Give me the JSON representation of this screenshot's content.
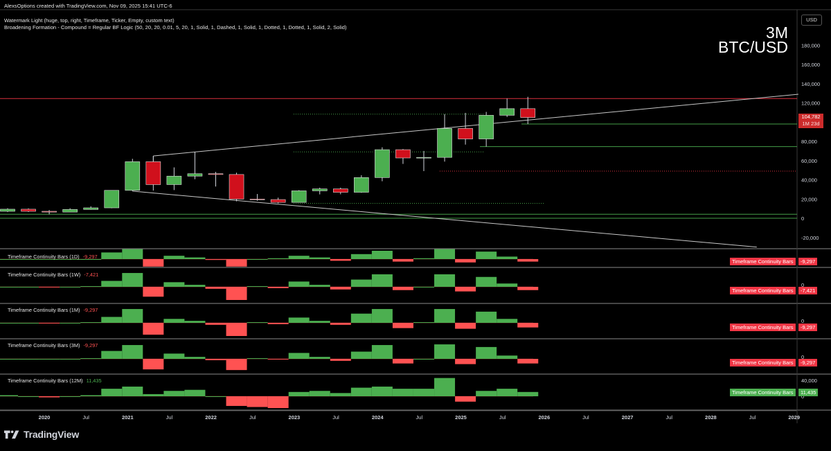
{
  "header": {
    "line1": "AlexsOptions created with TradingView.com, Nov 09, 2025 15:41 UTC-6",
    "line2": "Watermark Light (huge, top, right, Timeframe, Ticker, Empty, custom text)",
    "line3": "Broadening Formation - Compound = Regular BF Logic (50, 20, 20, 0.01, 5, 20, 1, Solid, 1, Dashed, 1, Solid, 1, Dotted, 1, Dotted, 1, Solid, 2, Solid)"
  },
  "currency_button": "USD",
  "watermark": {
    "timeframe": "3M",
    "ticker": "BTC/USD"
  },
  "price_badge": {
    "price": "104,782",
    "countdown": "1M 23d"
  },
  "colors": {
    "up": "#4caf50",
    "down": "#ff5252",
    "candle_down": "#d0101c",
    "background": "#000000",
    "resistance": "#f23645",
    "support": "#4caf50"
  },
  "chart_data": [
    {
      "type": "candlestick",
      "title": "BTC/USD 3M",
      "ylim": [
        -30000,
        205000
      ],
      "y_ticks": [
        -20000,
        0,
        20000,
        40000,
        60000,
        80000,
        100000,
        120000,
        140000,
        160000,
        180000
      ],
      "y_tick_labels": [
        "-20,000",
        "0",
        "20,000",
        "40,000",
        "60,000",
        "80,000",
        "100,000",
        "120,000",
        "140,000",
        "160,000",
        "180,000"
      ],
      "x_labels": [
        "2020",
        "Jul",
        "2021",
        "Jul",
        "2022",
        "Jul",
        "2023",
        "Jul",
        "2024",
        "Jul",
        "2025",
        "Jul",
        "2026",
        "Jul",
        "2027",
        "Jul",
        "2028",
        "Jul",
        "2029"
      ],
      "candles": [
        {
          "o": 7200,
          "h": 10400,
          "l": 6400,
          "c": 9400
        },
        {
          "o": 9400,
          "h": 10200,
          "l": 6500,
          "c": 7200
        },
        {
          "o": 7200,
          "h": 8500,
          "l": 4100,
          "c": 6400
        },
        {
          "o": 6400,
          "h": 10400,
          "l": 6400,
          "c": 9100
        },
        {
          "o": 9100,
          "h": 12400,
          "l": 8900,
          "c": 10800
        },
        {
          "o": 10800,
          "h": 29000,
          "l": 10400,
          "c": 29000
        },
        {
          "o": 29000,
          "h": 61800,
          "l": 28200,
          "c": 58800
        },
        {
          "o": 58800,
          "h": 64800,
          "l": 28800,
          "c": 35000
        },
        {
          "o": 35000,
          "h": 52900,
          "l": 29300,
          "c": 43800
        },
        {
          "o": 43800,
          "h": 69000,
          "l": 40600,
          "c": 46300
        },
        {
          "o": 46300,
          "h": 48200,
          "l": 33000,
          "c": 45500
        },
        {
          "o": 45500,
          "h": 47400,
          "l": 17600,
          "c": 19900
        },
        {
          "o": 19900,
          "h": 25200,
          "l": 18200,
          "c": 19400
        },
        {
          "o": 19400,
          "h": 21400,
          "l": 15500,
          "c": 16500
        },
        {
          "o": 16500,
          "h": 29200,
          "l": 16500,
          "c": 28500
        },
        {
          "o": 28500,
          "h": 31800,
          "l": 24800,
          "c": 30500
        },
        {
          "o": 30500,
          "h": 31800,
          "l": 24900,
          "c": 27000
        },
        {
          "o": 27000,
          "h": 44700,
          "l": 26500,
          "c": 42300
        },
        {
          "o": 42300,
          "h": 73800,
          "l": 38500,
          "c": 71300
        },
        {
          "o": 71300,
          "h": 72000,
          "l": 56500,
          "c": 62700
        },
        {
          "o": 62700,
          "h": 70000,
          "l": 49000,
          "c": 63300
        },
        {
          "o": 63300,
          "h": 108300,
          "l": 58900,
          "c": 93400
        },
        {
          "o": 93400,
          "h": 109600,
          "l": 76600,
          "c": 82500
        },
        {
          "o": 82500,
          "h": 110600,
          "l": 74500,
          "c": 107100
        },
        {
          "o": 107100,
          "h": 124500,
          "l": 105300,
          "c": 114000
        },
        {
          "o": 114000,
          "h": 126300,
          "l": 98000,
          "c": 104800
        }
      ],
      "levels": [
        {
          "value": 124500,
          "color": "#f23645",
          "style": "solid"
        },
        {
          "value": 98000,
          "color": "#4caf50",
          "style": "solid"
        },
        {
          "value": 74500,
          "color": "#4caf50",
          "style": "solid"
        },
        {
          "value": 49000,
          "color": "#f23645",
          "style": "dotted"
        },
        {
          "value": 15500,
          "color": "#4caf50",
          "style": "dotted"
        },
        {
          "value": 4100,
          "color": "#4caf50",
          "style": "solid"
        },
        {
          "value": 0,
          "color": "#4caf50",
          "style": "solid"
        },
        {
          "value": 108300,
          "color": "#4caf50",
          "style": "dotted"
        },
        {
          "value": 69000,
          "color": "#4caf50",
          "style": "dotted"
        }
      ],
      "trendlines": [
        {
          "from": {
            "bar": 7,
            "value": 64800
          },
          "to": {
            "bar": 38,
            "value": 129000
          }
        },
        {
          "from": {
            "bar": 6,
            "value": 28200
          },
          "to": {
            "bar": 36,
            "value": -30000
          }
        }
      ]
    },
    {
      "type": "bar",
      "title": "Timeframe Continuity Bars (1D)",
      "last_value": "-9,297",
      "badge": "Timeframe Continuity Bars",
      "values": [
        0,
        0,
        0,
        0,
        0,
        8,
        12,
        -9,
        4,
        2,
        -1,
        -9,
        0,
        1,
        4,
        2,
        -2,
        6,
        10,
        -3,
        1,
        12,
        -4,
        9,
        3,
        -3
      ]
    },
    {
      "type": "bar",
      "title": "Timeframe Continuity Bars (1W)",
      "last_value": "-7,421",
      "badge": "Timeframe Continuity Bars",
      "tick": "0",
      "values": [
        0,
        0,
        -1,
        0,
        1,
        9,
        21,
        -15,
        7,
        3,
        -3,
        -20,
        1,
        -2,
        8,
        3,
        -4,
        11,
        19,
        -5,
        0,
        19,
        -7,
        15,
        5,
        -5
      ]
    },
    {
      "type": "bar",
      "title": "Timeframe Continuity Bars (1M)",
      "last_value": "-9,297",
      "badge": "Timeframe Continuity Bars",
      "tick": "0",
      "values": [
        0,
        0,
        -1,
        0,
        1,
        9,
        21,
        -18,
        6,
        3,
        -3,
        -20,
        1,
        -2,
        8,
        3,
        -3,
        14,
        21,
        -8,
        1,
        21,
        -9,
        17,
        6,
        -7
      ]
    },
    {
      "type": "bar",
      "title": "Timeframe Continuity Bars (3M)",
      "last_value": "-9,297",
      "badge": "Timeframe Continuity Bars",
      "tick": "0",
      "values": [
        0,
        0,
        0,
        0,
        1,
        12,
        21,
        -16,
        8,
        3,
        -2,
        -17,
        1,
        -1,
        9,
        3,
        -3,
        11,
        21,
        -7,
        0,
        22,
        -8,
        18,
        5,
        -7
      ]
    },
    {
      "type": "bar",
      "title": "Timeframe Continuity Bars (12M)",
      "last_value": "11,435",
      "badge": "Timeframe Continuity Bars",
      "ticks": [
        "40,000",
        "0"
      ],
      "values": [
        1,
        0,
        -1,
        0,
        1,
        7,
        9,
        2,
        5,
        6,
        0,
        -9,
        -10,
        -11,
        4,
        5,
        3,
        8,
        9,
        7,
        7,
        17,
        -5,
        5,
        7,
        4
      ]
    }
  ]
}
